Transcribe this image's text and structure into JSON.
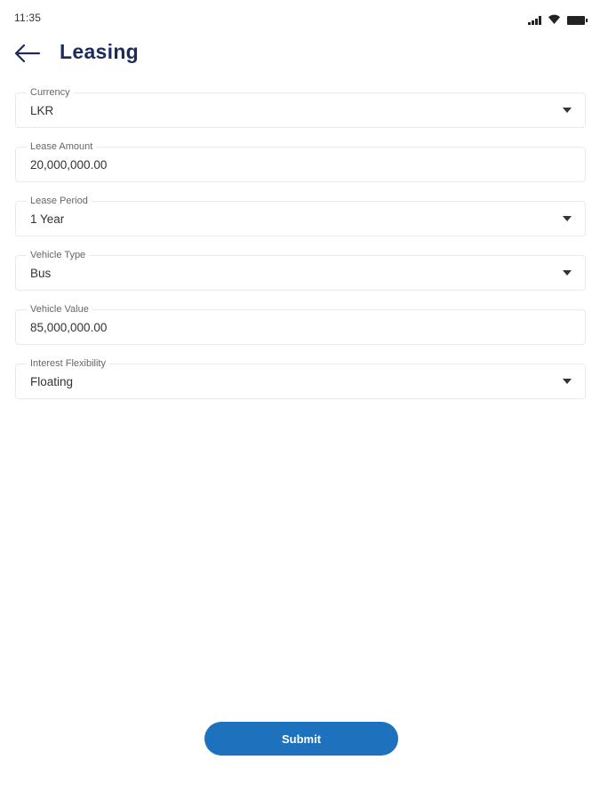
{
  "status_bar": {
    "time": "11:35",
    "icons": [
      "signal-icon",
      "wifi-icon",
      "battery-icon"
    ]
  },
  "header": {
    "back_icon": "arrow-left-icon",
    "title": "Leasing"
  },
  "form": {
    "currency": {
      "label": "Currency",
      "value": "LKR",
      "type": "dropdown"
    },
    "lease_amount": {
      "label": "Lease Amount",
      "value": "20,000,000.00",
      "type": "text"
    },
    "lease_period": {
      "label": "Lease Period",
      "value": "1 Year",
      "type": "dropdown"
    },
    "vehicle_type": {
      "label": "Vehicle Type",
      "value": "Bus",
      "type": "dropdown"
    },
    "vehicle_value": {
      "label": "Vehicle Value",
      "value": "85,000,000.00",
      "type": "text"
    },
    "interest_flexibility": {
      "label": "Interest Flexibility",
      "value": "Floating",
      "type": "dropdown"
    }
  },
  "submit_label": "Submit",
  "colors": {
    "primary": "#1e72bd",
    "title": "#1c2b5c",
    "field_border": "#eaeaea"
  }
}
